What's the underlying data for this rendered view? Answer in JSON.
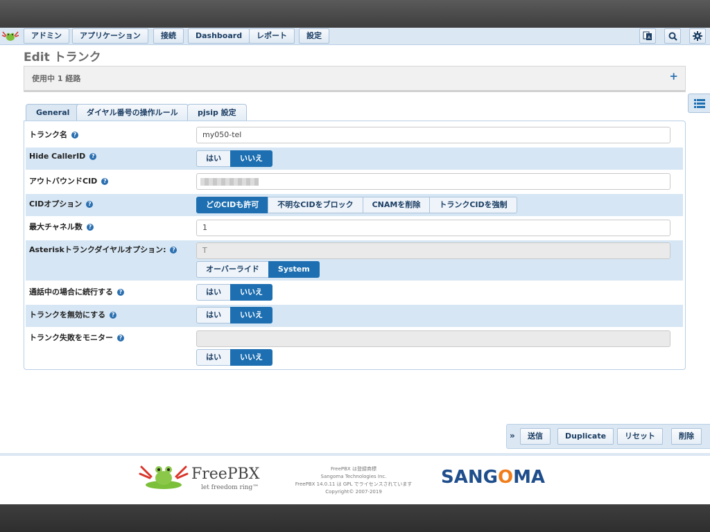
{
  "nav": {
    "items": [
      {
        "label": "アドミン"
      },
      {
        "label": "アプリケーション"
      },
      {
        "label": "接続"
      },
      {
        "label": "Dashboard"
      },
      {
        "label": "レポート"
      },
      {
        "label": "設定"
      }
    ],
    "icons": [
      "language-icon",
      "search-icon",
      "gear-icon"
    ]
  },
  "page": {
    "title": "Edit トランク",
    "usage_text": "使用中 1 経路",
    "usage_toggle": "+"
  },
  "tabs": [
    {
      "label": "General",
      "active": true
    },
    {
      "label": "ダイヤル番号の操作ルール",
      "active": false
    },
    {
      "label": "pjsip 設定",
      "active": false
    }
  ],
  "form": {
    "trunk_name": {
      "label": "トランク名",
      "value": "my050-tel"
    },
    "hide_callerid": {
      "label": "Hide CallerID",
      "options": [
        "はい",
        "いいえ"
      ],
      "selected": "いいえ"
    },
    "outbound_cid": {
      "label": "アウトバウンドCID",
      "value": ""
    },
    "cid_options": {
      "label": "CIDオプション",
      "options": [
        "どのCIDも許可",
        "不明なCIDをブロック",
        "CNAMを削除",
        "トランクCIDを強制"
      ],
      "selected": "どのCIDも許可"
    },
    "max_channels": {
      "label": "最大チャネル数",
      "value": "1"
    },
    "dial_options": {
      "label": "Asteriskトランクダイヤルオプション:",
      "value": "T",
      "options": [
        "オーバーライド",
        "System"
      ],
      "selected": "System"
    },
    "continue_if_busy": {
      "label": "通話中の場合に続行する",
      "options": [
        "はい",
        "いいえ"
      ],
      "selected": "いいえ"
    },
    "disable_trunk": {
      "label": "トランクを無効にする",
      "options": [
        "はい",
        "いいえ"
      ],
      "selected": "いいえ"
    },
    "monitor_failures": {
      "label": "トランク失敗をモニター",
      "value": "",
      "options": [
        "はい",
        "いいえ"
      ],
      "selected": "いいえ"
    }
  },
  "actions": {
    "arrow": "»",
    "submit": "送信",
    "duplicate": "Duplicate",
    "reset": "リセット",
    "delete": "削除"
  },
  "footer": {
    "brand": "FreePBX",
    "tagline": "let freedom ring™",
    "info": [
      "FreePBX は登録商標",
      "Sangoma Technologies Inc.",
      "FreePBX 14.0.11 は GPL でライセンスされています",
      "Copyright© 2007-2019"
    ],
    "partner_left": "SANG",
    "partner_o": "O",
    "partner_right": "MA"
  },
  "colors": {
    "accent": "#1d6fb1",
    "row_shade": "#d6e6f4",
    "nav_bg": "#dbe7f3"
  }
}
